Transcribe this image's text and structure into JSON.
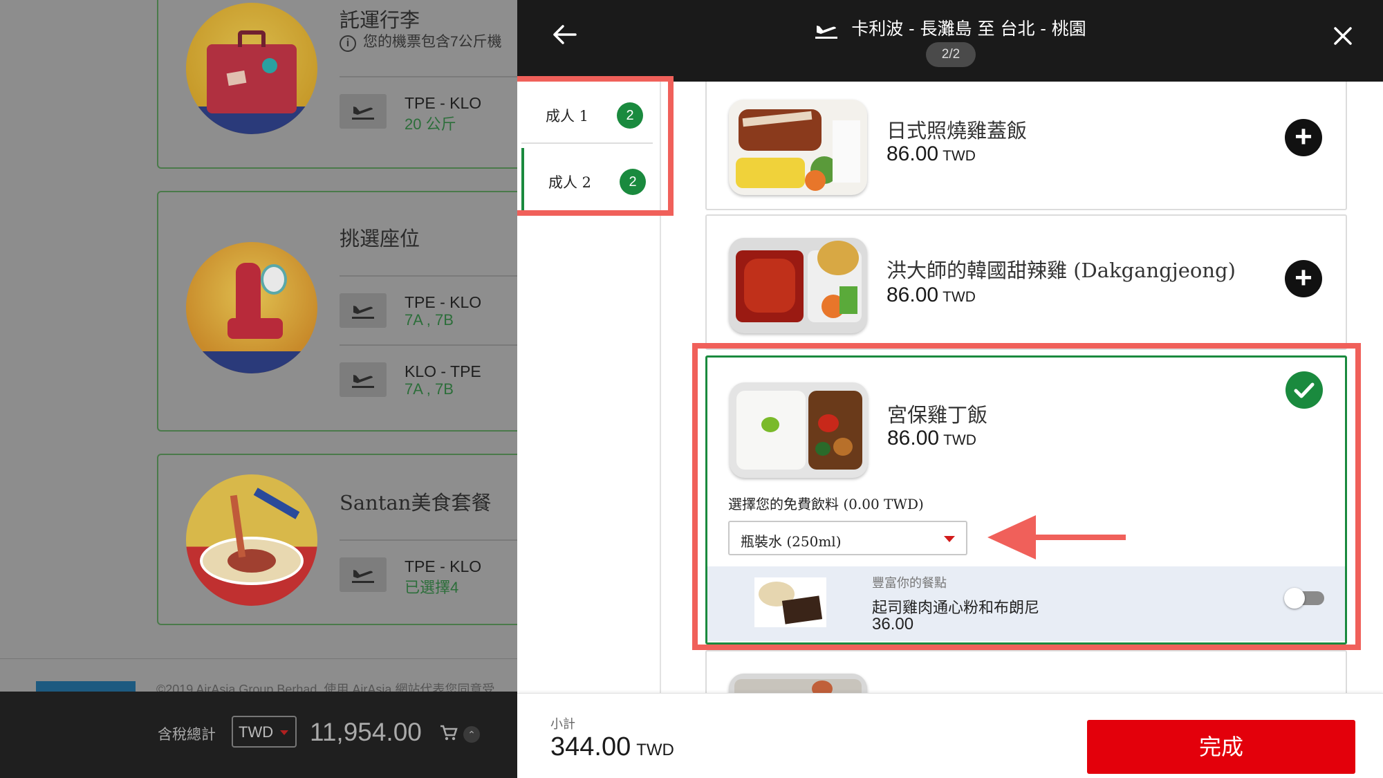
{
  "background": {
    "baggage": {
      "title": "託運行李",
      "info": "您的機票包含7公斤機",
      "rows": [
        {
          "route": "TPE - KLO",
          "detail": "20 公斤"
        }
      ]
    },
    "seats": {
      "title": "挑選座位",
      "rows": [
        {
          "route": "TPE - KLO",
          "detail": "7A , 7B"
        },
        {
          "route": "KLO - TPE",
          "detail": "7A , 7B"
        }
      ]
    },
    "meals": {
      "title": "Santan美食套餐",
      "rows": [
        {
          "route": "TPE - KLO",
          "detail": "已選擇4"
        }
      ]
    },
    "copyright": "©2019 AirAsia Group Berhad. 使用 AirAsia 網站代表您同意受",
    "total_label": "含稅總計",
    "currency": "TWD",
    "total_amount": "11,954.00"
  },
  "modal": {
    "route_title": "卡利波 - 長灘島 至 台北 - 桃園",
    "page_indicator": "2/2",
    "passengers": [
      {
        "label": "成人 1",
        "count": "2"
      },
      {
        "label": "成人 2",
        "count": "2"
      }
    ],
    "active_passenger": "成人 2",
    "meals": [
      {
        "name": "日式照燒雞蓋飯",
        "price": "86.00",
        "currency": "TWD",
        "selected": false
      },
      {
        "name": "洪大師的韓國甜辣雞 (Dakgangjeong)",
        "price": "86.00",
        "currency": "TWD",
        "selected": false
      },
      {
        "name": "宮保雞丁飯",
        "price": "86.00",
        "currency": "TWD",
        "selected": true,
        "drink_label": "選擇您的免費飲料 (0.00 TWD)",
        "drink_selected": "瓶裝水 (250ml)",
        "addon": {
          "kicker": "豐富你的餐點",
          "name": "起司雞肉通心粉和布朗尼",
          "price": "36.00",
          "enabled": false
        }
      }
    ],
    "subtotal_label": "小計",
    "subtotal_amount": "344.00",
    "subtotal_currency": "TWD",
    "done_label": "完成"
  },
  "colors": {
    "accent_green": "#1a8a3e",
    "brand_red": "#e3000b",
    "annotation": "#f0605a",
    "header_dark": "#1a1a1a"
  },
  "icons": [
    "back-arrow-icon",
    "close-icon",
    "plane-depart-icon",
    "plus-icon",
    "check-icon",
    "dropdown-caret-icon",
    "cart-icon",
    "chevron-up-icon",
    "info-icon"
  ]
}
